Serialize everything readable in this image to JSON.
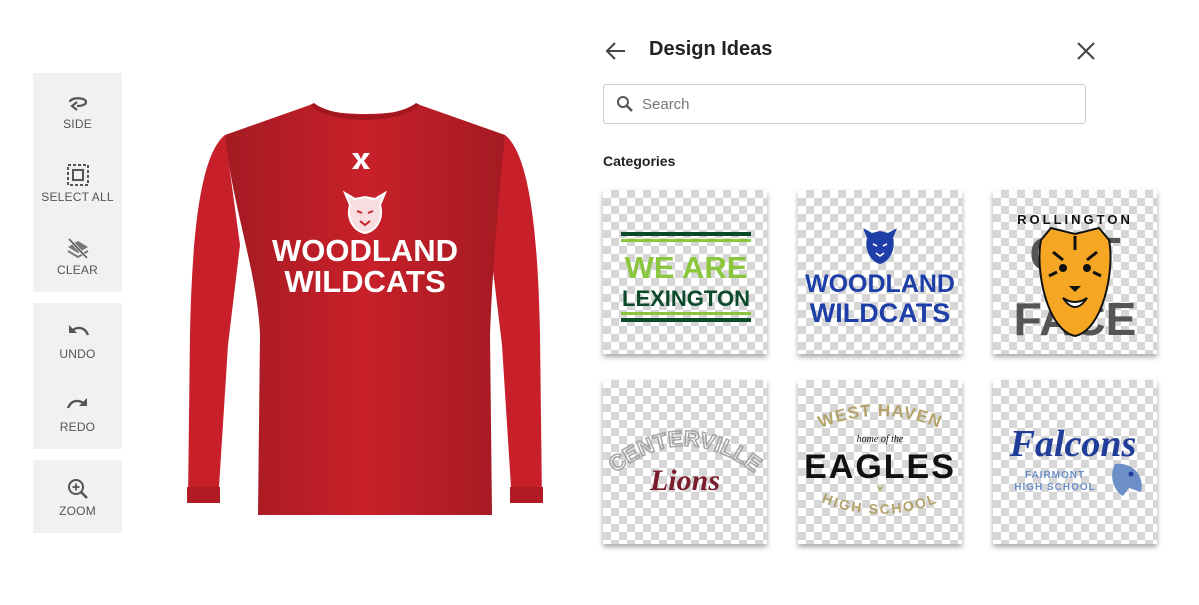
{
  "toolbar": {
    "side_label": "SIDE",
    "select_all_label": "SELECT ALL",
    "clear_label": "CLEAR",
    "undo_label": "UNDO",
    "redo_label": "REDO",
    "zoom_label": "ZOOM"
  },
  "shirt": {
    "color": "#c8202a",
    "line1": "WOODLAND",
    "line2": "WILDCATS"
  },
  "panel": {
    "title": "Design Ideas",
    "search_placeholder": "Search",
    "categories_label": "Categories"
  },
  "designs": [
    {
      "line1": "WE ARE",
      "line2": "LEXINGTON",
      "colors": [
        "#8cc63f",
        "#0b4a2a"
      ]
    },
    {
      "line1": "WOODLAND",
      "line2": "WILDCATS",
      "colors": [
        "#1e3fa8"
      ]
    },
    {
      "line1": "ROLLINGTON",
      "bg_word_top": "CAT",
      "bg_word_bottom": "FACE",
      "colors": [
        "#f5a623",
        "#555555"
      ]
    },
    {
      "line1": "CENTERVILLE",
      "line2": "Lions",
      "colors": [
        "#a5a5a5",
        "#7a1c2b"
      ]
    },
    {
      "line1": "WEST HAVEN",
      "line2": "home of the",
      "line3": "EAGLES",
      "line4": "HIGH SCHOOL",
      "colors": [
        "#b3a36b",
        "#111111"
      ]
    },
    {
      "line1": "Falcons",
      "line2": "FAIRMONT",
      "line3": "HIGH SCHOOL",
      "colors": [
        "#1f3d99",
        "#6d8fc8"
      ]
    }
  ]
}
